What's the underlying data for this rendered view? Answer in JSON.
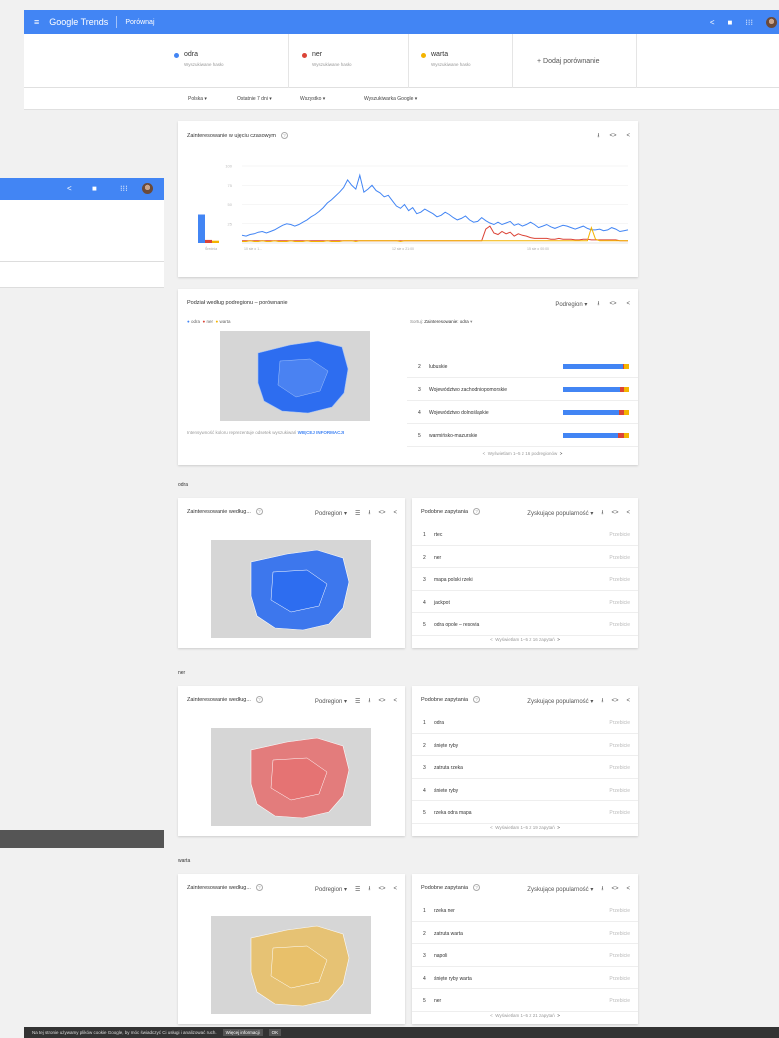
{
  "topbar": {
    "menu_icon": "menu-icon",
    "logo": "Google Trends",
    "page": "Porównaj",
    "share_icon": "share-icon",
    "feedback_icon": "feedback-icon",
    "apps_icon": "apps-icon"
  },
  "terms": [
    {
      "name": "odra",
      "sub": "Wyszukiwane hasło",
      "color": "#4285f4"
    },
    {
      "name": "ner",
      "sub": "Wyszukiwane hasło",
      "color": "#db4437"
    },
    {
      "name": "warta",
      "sub": "Wyszukiwane hasło",
      "color": "#f4b400"
    }
  ],
  "add_compare": "+   Dodaj porównanie",
  "filters": {
    "country": "Polska  ▾",
    "period": "Ostatnie 7 dni  ▾",
    "category": "Wszystko  ▾",
    "type": "Wyszukiwarka Google  ▾"
  },
  "interest_over_time": {
    "title": "Zainteresowanie w ujęciu czasowym",
    "average_label": "Średnia",
    "x_labels": [
      "10 sie o 1...",
      "12 sie o 21:00",
      "15 sie o 00:00"
    ],
    "y_ticks": [
      "100",
      "75",
      "50",
      "25"
    ]
  },
  "chart_data": {
    "type": "line",
    "ylim": [
      0,
      100
    ],
    "x_labels": [
      "10 sie o 1...",
      "12 sie o 21:00",
      "15 sie o 00:00"
    ],
    "averages": [
      {
        "name": "odra",
        "value": 37
      },
      {
        "name": "ner",
        "value": 4
      },
      {
        "name": "warta",
        "value": 3
      }
    ],
    "series": [
      {
        "name": "odra",
        "color": "#4285f4",
        "values": [
          10,
          9,
          11,
          12,
          14,
          15,
          13,
          15,
          17,
          20,
          23,
          25,
          24,
          22,
          24,
          27,
          30,
          34,
          37,
          41,
          46,
          52,
          56,
          61,
          66,
          72,
          82,
          75,
          70,
          88,
          66,
          70,
          75,
          68,
          65,
          60,
          62,
          55,
          48,
          45,
          50,
          42,
          46,
          38,
          40,
          44,
          41,
          38,
          34,
          36,
          40,
          37,
          33,
          30,
          32,
          35,
          30,
          27,
          28,
          33,
          29,
          26,
          24,
          27,
          24,
          26,
          28,
          23,
          25,
          22,
          24,
          27,
          24,
          20,
          22,
          24,
          21,
          19,
          21,
          23,
          22,
          20,
          18,
          20,
          22,
          19,
          17,
          17,
          18,
          16,
          17,
          20,
          18,
          15,
          16,
          17
        ]
      },
      {
        "name": "ner",
        "color": "#db4437",
        "values": [
          3,
          3,
          3,
          3,
          3,
          3,
          3,
          3,
          3,
          3,
          3,
          3,
          3,
          3,
          3,
          3,
          3,
          3,
          3,
          3,
          3,
          3,
          3,
          3,
          3,
          3,
          3,
          3,
          3,
          3,
          3,
          3,
          3,
          3,
          3,
          3,
          3,
          3,
          3,
          3,
          3,
          3,
          3,
          3,
          3,
          3,
          3,
          3,
          3,
          3,
          3,
          3,
          3,
          3,
          3,
          3,
          3,
          3,
          3,
          3,
          18,
          22,
          13,
          11,
          15,
          12,
          14,
          9,
          12,
          10,
          9,
          7,
          6,
          6,
          6,
          6,
          5,
          5,
          6,
          5,
          5,
          5,
          4,
          4,
          5,
          5,
          4,
          4,
          4,
          4,
          4,
          4,
          4,
          3,
          3,
          3
        ]
      },
      {
        "name": "warta",
        "color": "#f4b400",
        "values": [
          2,
          2,
          3,
          2,
          2,
          3,
          2,
          2,
          3,
          2,
          2,
          2,
          3,
          2,
          2,
          2,
          3,
          2,
          2,
          2,
          2,
          3,
          2,
          2,
          2,
          3,
          3,
          3,
          2,
          3,
          3,
          3,
          3,
          3,
          3,
          3,
          3,
          3,
          3,
          2,
          3,
          3,
          3,
          3,
          3,
          3,
          3,
          3,
          3,
          3,
          3,
          3,
          3,
          3,
          3,
          3,
          3,
          3,
          3,
          3,
          3,
          3,
          3,
          3,
          3,
          3,
          3,
          3,
          3,
          3,
          3,
          3,
          3,
          3,
          3,
          3,
          3,
          3,
          3,
          3,
          3,
          3,
          3,
          3,
          3,
          3,
          20,
          5,
          3,
          3,
          3,
          3,
          3,
          3,
          3,
          3
        ]
      }
    ]
  },
  "subregion": {
    "title": "Podział według podregionu – porównanie",
    "mode": "Podregion",
    "legend": [
      "odra",
      "ner",
      "warta"
    ],
    "sort_label": "Sortuj:",
    "sort_value": "Zainteresowanie: odra",
    "note": "Intensywność koloru reprezentuje odsetek wyszukiwań",
    "more": "WIĘCEJ INFORMACJI",
    "rows": [
      {
        "idx": "2",
        "name": "lubuskie",
        "shares": [
          0.91,
          0.02,
          0.07
        ]
      },
      {
        "idx": "3",
        "name": "Województwo zachodniopomorskie",
        "shares": [
          0.86,
          0.06,
          0.08
        ]
      },
      {
        "idx": "4",
        "name": "Województwo dolnośląskie",
        "shares": [
          0.85,
          0.07,
          0.08
        ]
      },
      {
        "idx": "5",
        "name": "warmińsko-mazurskie",
        "shares": [
          0.84,
          0.08,
          0.08
        ]
      }
    ],
    "pager": "Wyświetlam 1–5 z 16 podregionów"
  },
  "blocks": [
    {
      "label": "odra",
      "map_title": "Zainteresowanie według...",
      "mode": "Podregion",
      "color": "#2d6df0",
      "query_title": "Podobne zapytania",
      "query_mode": "Zyskujące popularność",
      "queries": [
        "rtec",
        "ner",
        "mapa polski rzeki",
        "jackpot",
        "odra opole – resovia"
      ],
      "value": "Przebicie",
      "pager": "Wyświetlam 1–5 z 16 zapytań"
    },
    {
      "label": "ner",
      "map_title": "Zainteresowanie według...",
      "mode": "Podregion",
      "color": "#e57373",
      "query_title": "Podobne zapytania",
      "query_mode": "Zyskujące popularność",
      "queries": [
        "odra",
        "śnięte ryby",
        "zatruta rzeka",
        "śniete ryby",
        "rzeka odra mapa"
      ],
      "value": "Przebicie",
      "pager": "Wyświetlam 1–5 z 19 zapytań"
    },
    {
      "label": "warta",
      "map_title": "Zainteresowanie według...",
      "mode": "Podregion",
      "color": "#e8c06a",
      "query_title": "Podobne zapytania",
      "query_mode": "Zyskujące popularność",
      "queries": [
        "rzeka ner",
        "zatruta warta",
        "napoli",
        "śnięte ryby warta",
        "ner"
      ],
      "value": "Przebicie",
      "pager": "Wyświetlam 1–5 z 21 zapytań"
    }
  ],
  "cookie": {
    "text": "Na tej stronie używamy plików cookie Google, by móc świadczyć Ci usługi i analizować ruch.",
    "more": "Więcej informacji",
    "ok": "OK"
  }
}
